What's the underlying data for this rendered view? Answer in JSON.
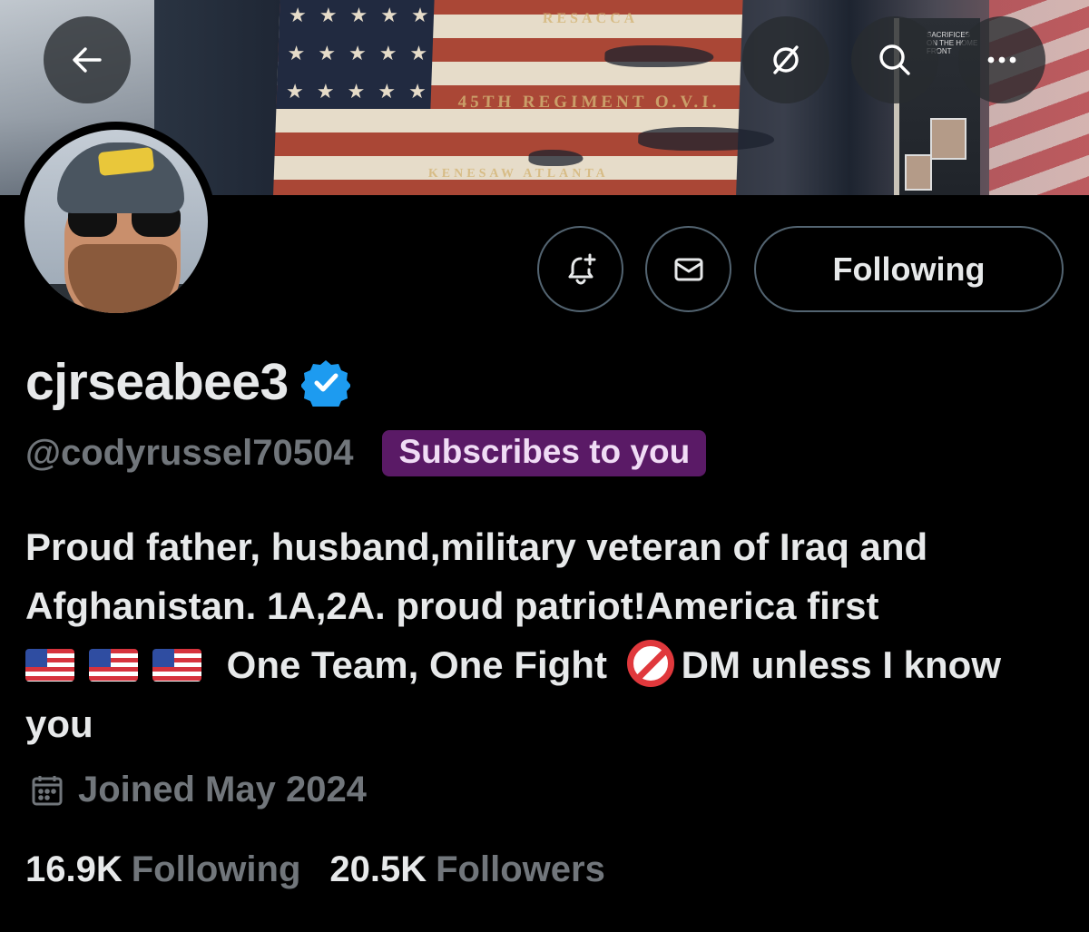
{
  "profile": {
    "display_name": "cjrseabee3",
    "handle": "@codyrussel70504",
    "subscribes_badge": "Subscribes to you",
    "bio_line1": "Proud father, husband,military veteran of Iraq and Afghanistan. 1A,2A. proud patriot!America first",
    "bio_line2": "One Team, One Fight",
    "bio_line3": "DM unless I know you",
    "joined": "Joined May 2024",
    "verified": true
  },
  "stats": {
    "following_count": "16.9K",
    "following_label": "Following",
    "followers_count": "20.5K",
    "followers_label": "Followers"
  },
  "actions": {
    "following_label": "Following"
  },
  "icons": {
    "back": "arrow-left-icon",
    "grok": "grok-icon",
    "search": "search-icon",
    "more": "more-icon",
    "notify": "bell-plus-icon",
    "message": "envelope-icon",
    "verified": "verified-badge-icon",
    "calendar": "calendar-icon",
    "flag_emoji": "us-flag-emoji",
    "no_entry": "prohibited-emoji"
  },
  "banner": {
    "flag_text_top": "RESACCA",
    "flag_text_mid": "45TH REGIMENT O.V.I.",
    "flag_text_bottom": "KENESAW ATLANTA",
    "case_text": "SACRIFICES ON THE HOME FRONT"
  },
  "colors": {
    "background": "#000000",
    "text": "#e7e9ea",
    "secondary_text": "#71767b",
    "border": "#536471",
    "verified_blue": "#1d9bf0",
    "badge_bg": "#5a1a66"
  }
}
